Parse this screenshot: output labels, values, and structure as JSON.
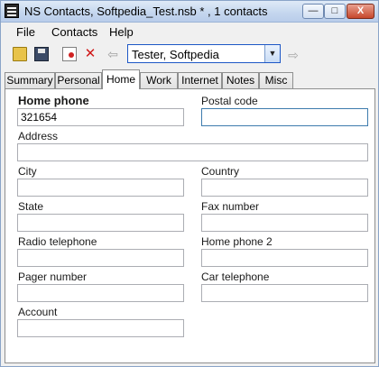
{
  "window": {
    "title": "NS Contacts, Softpedia_Test.nsb * , 1 contacts",
    "minimize_label": "—",
    "maximize_label": "□",
    "close_label": "X"
  },
  "menu": {
    "items": [
      "File",
      "Contacts",
      "Help"
    ]
  },
  "toolbar": {
    "icons": [
      "open-folder-icon",
      "save-icon",
      "new-contact-icon",
      "delete-icon",
      "back-arrow-icon",
      "forward-arrow-icon"
    ],
    "delete_glyph": "✕",
    "back_glyph": "⇦",
    "forward_glyph": "⇨",
    "contact_select": {
      "value": "Tester, Softpedia",
      "arrow": "▼"
    }
  },
  "tabs": [
    "Summary",
    "Personal",
    "Home",
    "Work",
    "Internet",
    "Notes",
    "Misc"
  ],
  "active_tab": "Home",
  "form": {
    "home_phone": {
      "label": "Home phone",
      "value": "321654"
    },
    "postal_code": {
      "label": "Postal code",
      "value": ""
    },
    "address": {
      "label": "Address",
      "value": ""
    },
    "city": {
      "label": "City",
      "value": ""
    },
    "country": {
      "label": "Country",
      "value": ""
    },
    "state": {
      "label": "State",
      "value": ""
    },
    "fax_number": {
      "label": "Fax number",
      "value": ""
    },
    "radio_telephone": {
      "label": "Radio telephone",
      "value": ""
    },
    "home_phone_2": {
      "label": "Home phone 2",
      "value": ""
    },
    "pager_number": {
      "label": "Pager number",
      "value": ""
    },
    "car_telephone": {
      "label": "Car telephone",
      "value": ""
    },
    "account": {
      "label": "Account",
      "value": ""
    }
  },
  "colors": {
    "titlebar": "#c4d6ee",
    "close_button": "#c7472c",
    "focus_border": "#3d7bad",
    "panel_background": "#ffffff"
  }
}
